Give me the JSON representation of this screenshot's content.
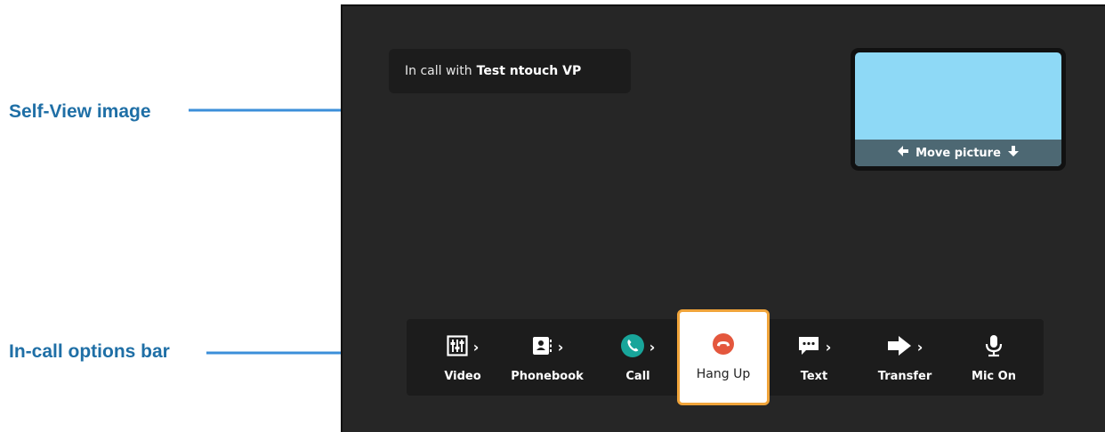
{
  "annotations": {
    "selfview_label": "Self-View image",
    "options_bar_label": "In-call options bar"
  },
  "call_status": {
    "prefix": "In call with",
    "name": "Test ntouch VP"
  },
  "selfview": {
    "move_label": "Move picture"
  },
  "options": [
    {
      "label": "Video",
      "icon": "video-settings-icon"
    },
    {
      "label": "Phonebook",
      "icon": "phonebook-icon"
    },
    {
      "label": "Call",
      "icon": "phone-icon"
    },
    {
      "label": "Hang Up",
      "icon": "hang-up-icon"
    },
    {
      "label": "Text",
      "icon": "chat-icon"
    },
    {
      "label": "Transfer",
      "icon": "transfer-icon"
    },
    {
      "label": "Mic On",
      "icon": "microphone-icon"
    }
  ],
  "colors": {
    "annotation": "#1f6fa6",
    "screen_bg": "#262626",
    "selfview": "#8ed9f6",
    "hangup_border": "#f0a43a",
    "hangup_icon": "#e4573d",
    "call_icon": "#18a59a"
  }
}
